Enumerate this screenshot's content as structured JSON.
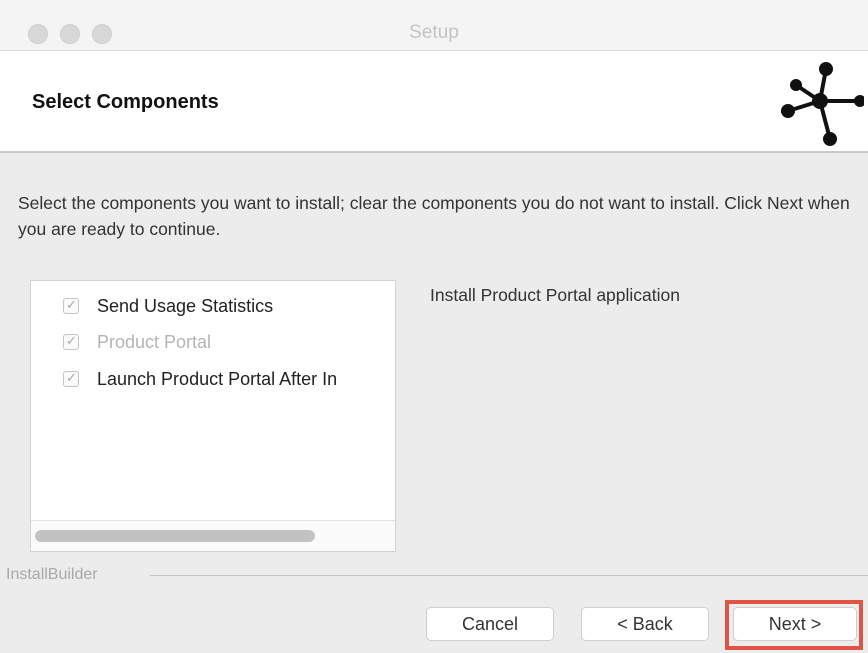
{
  "window": {
    "title": "Setup"
  },
  "header": {
    "title": "Select Components",
    "logo_icon": "installbuilder-star-logo-icon"
  },
  "instructions": "Select the components you want to install; clear the components you do not want to install. Click Next when you are ready to continue.",
  "components": [
    {
      "label": "Send Usage Statistics",
      "checked": true,
      "enabled": true
    },
    {
      "label": "Product Portal",
      "checked": true,
      "enabled": false
    },
    {
      "label": "Launch Product Portal After In",
      "checked": true,
      "enabled": true
    }
  ],
  "component_description": "Install Product Portal application",
  "footer": {
    "brand": "InstallBuilder",
    "cancel_label": "Cancel",
    "back_label": "< Back",
    "next_label": "Next >",
    "highlight_color": "#e05444"
  }
}
